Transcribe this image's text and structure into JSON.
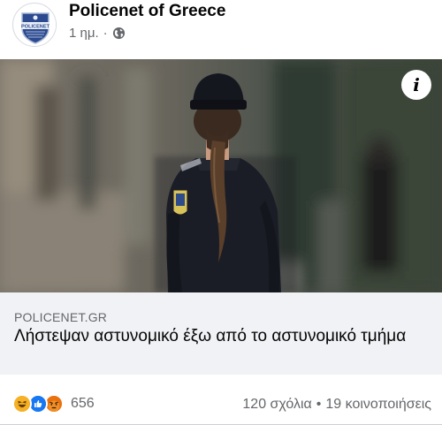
{
  "post": {
    "page_name": "Policenet of Greece",
    "time": "1 ημ.",
    "separator": "·",
    "privacy_icon": "globe-icon",
    "avatar_logo_text": "POLICENET"
  },
  "link_preview": {
    "domain": "POLICENET.GR",
    "headline": "Λήστεψαν αστυνομικό έξω από το αστυνομικό τμήμα",
    "info_icon_label": "i"
  },
  "engagement": {
    "reaction_icons": [
      "haha-icon",
      "like-icon",
      "angry-icon"
    ],
    "reaction_count": "656",
    "comments": "120 σχόλια",
    "separator": "•",
    "shares": "19 κοινοποιήσεις"
  },
  "colors": {
    "secondary_text": "#65676b",
    "link_box_bg": "#f0f2f5",
    "like_blue": "#1877f2",
    "angry_orange": "#e9710f",
    "haha_yellow": "#f7b125"
  }
}
